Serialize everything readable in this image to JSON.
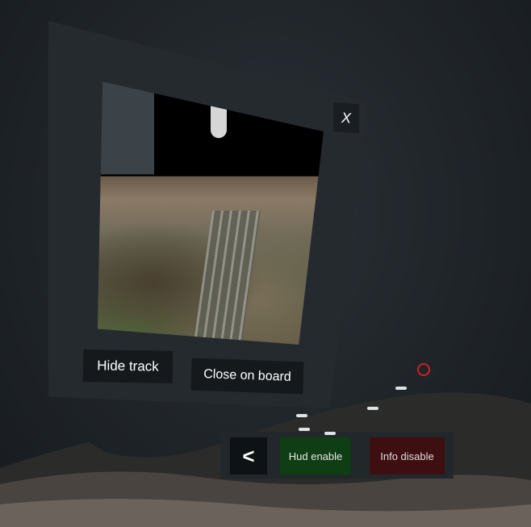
{
  "scene": {
    "panel": {
      "close_label": "X",
      "hide_track_label": "Hide track",
      "close_on_board_label": "Close on board"
    },
    "toolbar": {
      "back_label": "<",
      "hud_label": "Hud enable",
      "info_label": "Info disable"
    },
    "colors": {
      "hud_button_bg": "#0f3d14",
      "info_button_bg": "#3d0f10",
      "target_ring": "#d02020"
    },
    "icons": [
      "target-icon",
      "airplane-icon",
      "airplane-icon",
      "airplane-icon",
      "airplane-icon",
      "airplane-icon"
    ]
  }
}
